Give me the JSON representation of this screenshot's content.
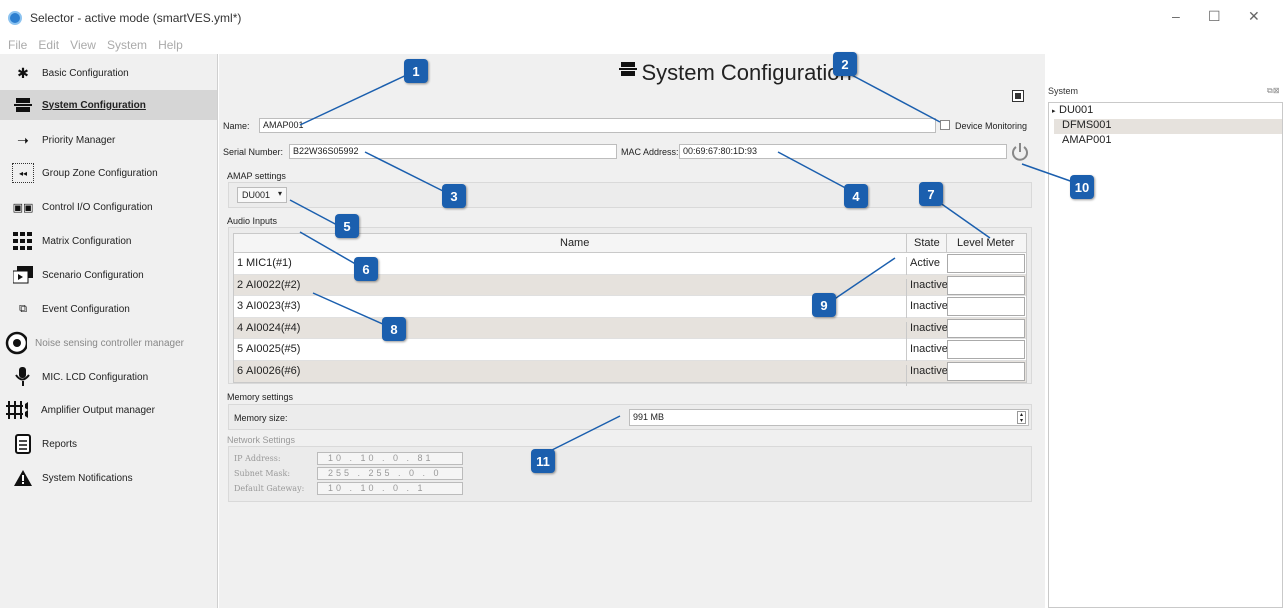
{
  "window": {
    "title": "Selector - active mode (smartVES.yml*)",
    "controls": [
      "–",
      "☐",
      "✕"
    ]
  },
  "menu": [
    "File",
    "Edit",
    "View",
    "System",
    "Help"
  ],
  "sidebar": {
    "items": [
      {
        "label": "Basic Configuration",
        "icon": "gear-icon",
        "active": false
      },
      {
        "label": "System Configuration",
        "icon": "system-icon",
        "active": true
      },
      {
        "label": "Priority Manager",
        "icon": "priority-arrow-icon",
        "active": false
      },
      {
        "label": "Group Zone Configuration",
        "icon": "group-zone-icon",
        "active": false
      },
      {
        "label": "Control I/O Configuration",
        "icon": "control-io-icon",
        "active": false
      },
      {
        "label": "Matrix Configuration",
        "icon": "matrix-icon",
        "active": false
      },
      {
        "label": "Scenario Configuration",
        "icon": "scenario-icon",
        "active": false
      },
      {
        "label": "Event Configuration",
        "icon": "event-icon",
        "active": false
      },
      {
        "label": "Noise sensing controller manager",
        "icon": "noise-sensor-icon",
        "active": false
      },
      {
        "label": "MIC. LCD Configuration",
        "icon": "microphone-icon",
        "active": false
      },
      {
        "label": "Amplifier Output manager",
        "icon": "amplifier-icon",
        "active": false
      },
      {
        "label": "Reports",
        "icon": "report-icon",
        "active": false
      },
      {
        "label": "System Notifications",
        "icon": "warning-icon",
        "active": false
      }
    ]
  },
  "main": {
    "header": "System Configuration",
    "name_label": "Name:",
    "name_value": "AMAP001",
    "device_monitoring_label": "Device Monitoring",
    "serial_label": "Serial Number:",
    "serial_value": "B22W36S05992",
    "mac_label": "MAC Address:",
    "mac_value": "00:69:67:80:1D:93",
    "amap_settings_label": "AMAP settings",
    "amap_select_value": "DU001",
    "audio_inputs_label": "Audio Inputs",
    "table_headers": {
      "name": "Name",
      "state": "State",
      "level": "Level Meter"
    },
    "rows": [
      {
        "num": "1",
        "name": "MIC1(#1)",
        "state": "Active"
      },
      {
        "num": "2",
        "name": "AI0022(#2)",
        "state": "Inactive"
      },
      {
        "num": "3",
        "name": "AI0023(#3)",
        "state": "Inactive"
      },
      {
        "num": "4",
        "name": "AI0024(#4)",
        "state": "Inactive"
      },
      {
        "num": "5",
        "name": "AI0025(#5)",
        "state": "Inactive"
      },
      {
        "num": "6",
        "name": "AI0026(#6)",
        "state": "Inactive"
      }
    ],
    "memory_settings_label": "Memory settings",
    "memory_size_label": "Memory size:",
    "memory_size_value": "991 MB",
    "network_settings_label": "Network Settings",
    "ip_label": "IP Address:",
    "ip_value": "10 . 10 . 0 . 81",
    "subnet_label": "Subnet Mask:",
    "subnet_value": "255 . 255 . 0 . 0",
    "gateway_label": "Default Gateway:",
    "gateway_value": "10 . 10 . 0 . 1"
  },
  "system_panel": {
    "title": "System",
    "tree": [
      "DU001",
      "DFMS001",
      "AMAP001"
    ]
  },
  "callouts": [
    "1",
    "2",
    "3",
    "4",
    "5",
    "6",
    "7",
    "8",
    "9",
    "10",
    "11"
  ],
  "colors": {
    "callout": "#1b5fae",
    "selected_row": "#e6e2dd",
    "sidebar_bg": "#f0f0f0"
  }
}
